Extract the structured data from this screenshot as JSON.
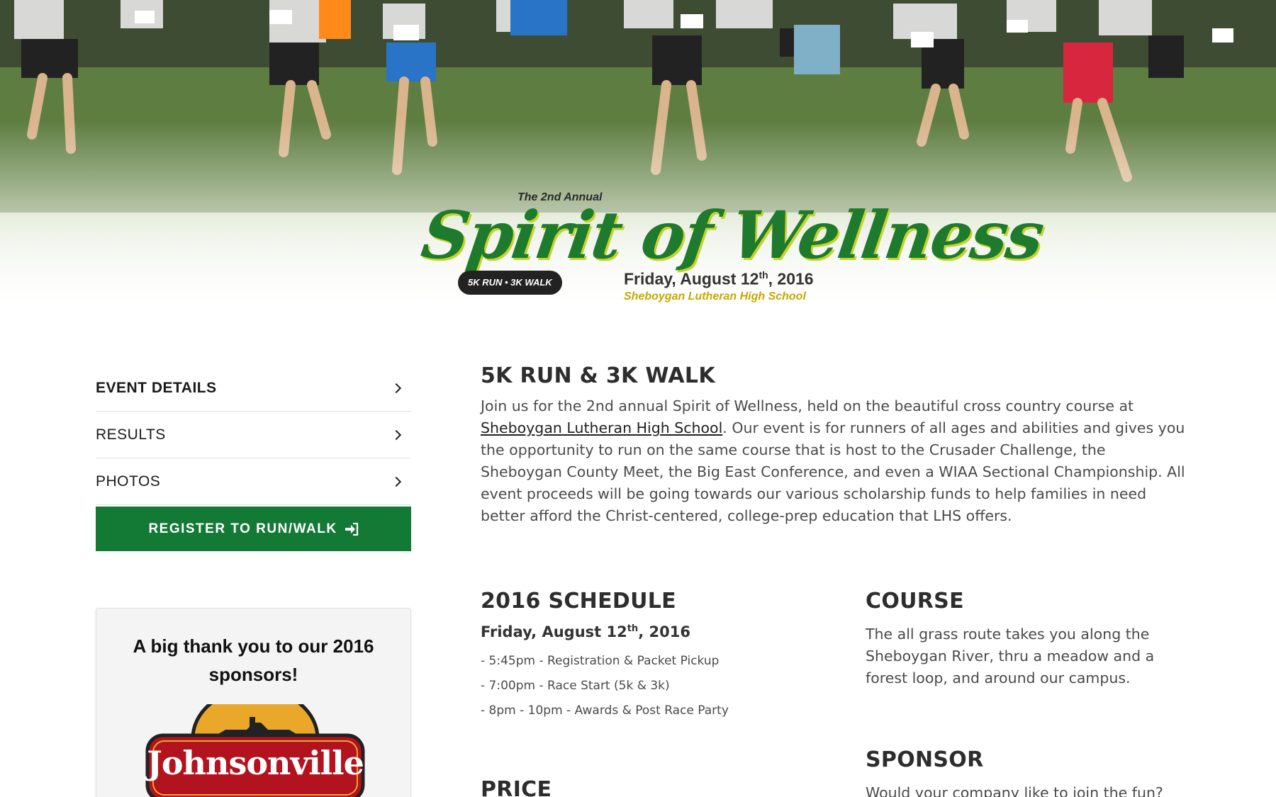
{
  "hero": {
    "annual": "The 2nd Annual",
    "title": "Spirit of Wellness",
    "pill": "5K RUN • 3K WALK",
    "date_main": "Friday, August 12",
    "date_sup": "th",
    "date_year": ", 2016",
    "school": "Sheboygan Lutheran High School"
  },
  "nav": {
    "items": [
      {
        "label": "EVENT DETAILS",
        "active": true
      },
      {
        "label": "RESULTS",
        "active": false
      },
      {
        "label": "PHOTOS",
        "active": false
      }
    ],
    "register_label": "REGISTER TO RUN/WALK"
  },
  "sponsors_box": {
    "title": "A big thank you to our 2016 sponsors!",
    "logo_text": "Johnsonville"
  },
  "intro": {
    "heading": "5K RUN & 3K WALK",
    "text_before": "Join us for the 2nd annual Spirit of Wellness, held on the beautiful cross country course at ",
    "link": "Sheboygan Lutheran High School",
    "text_after": ". Our event is for runners of all ages and abilities and gives you the opportunity to run on the same course that is host to the Crusader Challenge, the Sheboygan County Meet, the Big East Conference, and even a WIAA Sectional Championship. All event proceeds will be going towards our various scholarship funds to help families in need better afford the Christ-centered, college-prep education that LHS offers."
  },
  "schedule": {
    "heading": "2016 SCHEDULE",
    "date_main": "Friday, August 12",
    "date_sup": "th",
    "date_year": ", 2016",
    "items": [
      "- 5:45pm - Registration & Packet Pickup",
      "- 7:00pm - Race Start (5k & 3k)",
      "- 8pm - 10pm - Awards & Post Race Party"
    ]
  },
  "price": {
    "heading": "PRICE"
  },
  "course": {
    "heading": "COURSE",
    "text": "The all grass route takes you along the Sheboygan River, thru a meadow and a forest loop, and around our campus."
  },
  "sponsor_section": {
    "heading": "SPONSOR",
    "text": "Would your company like to join the fun?"
  },
  "colors": {
    "brand_green": "#137a36",
    "logo_green": "#1e7a2c",
    "logo_yellow": "#c8a700",
    "johnsonville_red": "#b3121f"
  }
}
